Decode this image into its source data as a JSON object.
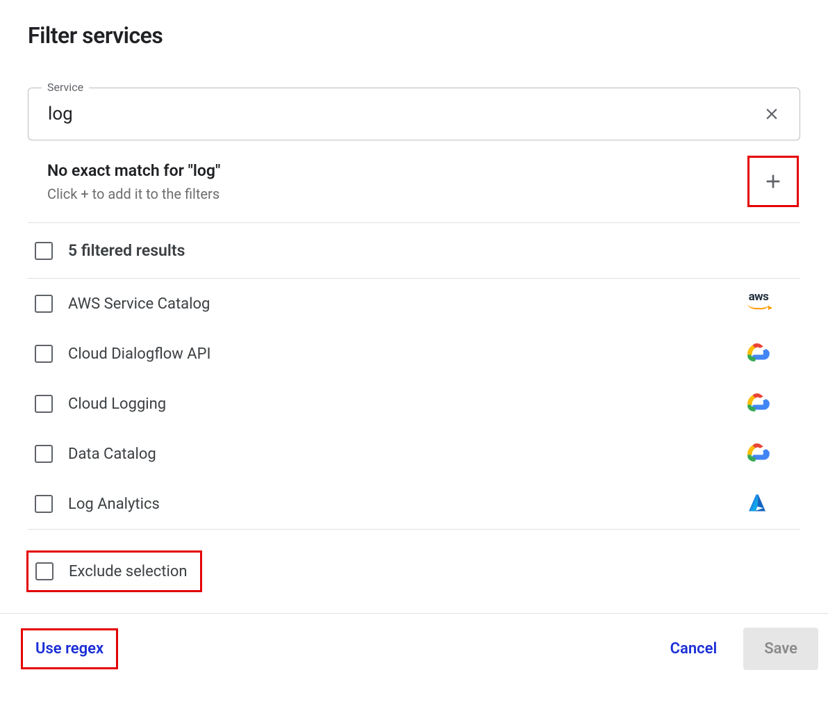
{
  "dialog": {
    "title": "Filter services"
  },
  "input": {
    "label": "Service",
    "value": "log"
  },
  "noMatch": {
    "headline": "No exact match for \"log\"",
    "sub": "Click + to add it to the filters"
  },
  "resultsHeader": {
    "label": "5 filtered results"
  },
  "results": [
    {
      "label": "AWS Service Catalog",
      "provider": "aws"
    },
    {
      "label": "Cloud Dialogflow API",
      "provider": "gcloud"
    },
    {
      "label": "Cloud Logging",
      "provider": "gcloud"
    },
    {
      "label": "Data Catalog",
      "provider": "gcloud"
    },
    {
      "label": "Log Analytics",
      "provider": "azure"
    }
  ],
  "exclude": {
    "label": "Exclude selection"
  },
  "footer": {
    "useRegex": "Use regex",
    "cancel": "Cancel",
    "save": "Save"
  }
}
